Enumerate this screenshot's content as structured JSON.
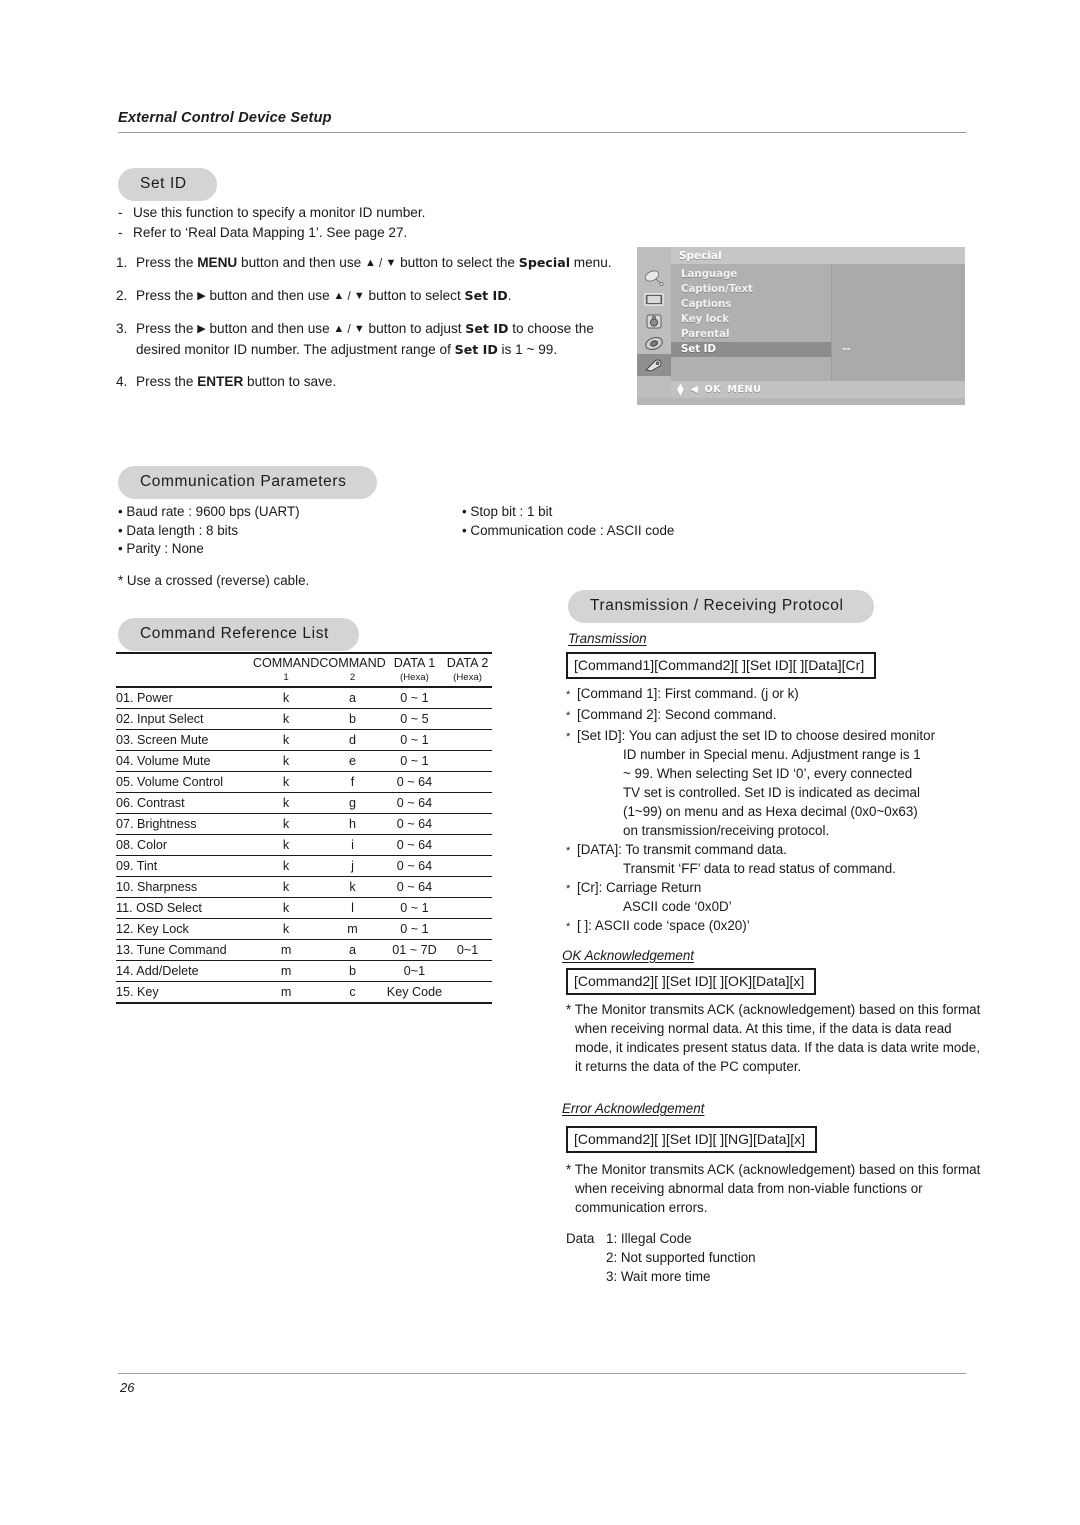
{
  "running_head": "External Control Device Setup",
  "page_number": "26",
  "set_id": {
    "heading": "Set ID",
    "notes": [
      "Use this function to specify a monitor ID number.",
      "Refer to ‘Real Data Mapping 1’. See page 27."
    ],
    "steps": [
      {
        "num": "1.",
        "parts": [
          {
            "t": "Press the ",
            "s": "n"
          },
          {
            "t": "MENU",
            "s": "b"
          },
          {
            "t": " button and then use ",
            "s": "n"
          },
          {
            "t": "▲",
            "s": "a"
          },
          {
            "t": " / ",
            "s": "sl"
          },
          {
            "t": "▼",
            "s": "a"
          },
          {
            "t": "  button to select the ",
            "s": "n"
          },
          {
            "t": "Special",
            "s": "bb"
          },
          {
            "t": " menu.",
            "s": "n"
          }
        ]
      },
      {
        "num": "2.",
        "parts": [
          {
            "t": "Press the ",
            "s": "n"
          },
          {
            "t": "▶",
            "s": "a"
          },
          {
            "t": " button and then use ",
            "s": "n"
          },
          {
            "t": "▲",
            "s": "a"
          },
          {
            "t": " / ",
            "s": "sl"
          },
          {
            "t": "▼",
            "s": "a"
          },
          {
            "t": "  button to select ",
            "s": "n"
          },
          {
            "t": "Set ID",
            "s": "bb"
          },
          {
            "t": ".",
            "s": "n"
          }
        ]
      },
      {
        "num": "3.",
        "parts": [
          {
            "t": "Press the ",
            "s": "n"
          },
          {
            "t": "▶",
            "s": "a"
          },
          {
            "t": " button and then use ",
            "s": "n"
          },
          {
            "t": "▲",
            "s": "a"
          },
          {
            "t": " / ",
            "s": "sl"
          },
          {
            "t": "▼",
            "s": "a"
          },
          {
            "t": " button to adjust  ",
            "s": "n"
          },
          {
            "t": "Set ID",
            "s": "bb"
          },
          {
            "t": " to choose the desired monitor ID number. The adjustment range of ",
            "s": "n"
          },
          {
            "t": "Set ID",
            "s": "bb"
          },
          {
            "t": " is 1 ~ 99.",
            "s": "n"
          }
        ]
      },
      {
        "num": "4.",
        "parts": [
          {
            "t": "Press the ",
            "s": "n"
          },
          {
            "t": "ENTER",
            "s": "b"
          },
          {
            "t": " button to save.",
            "s": "n"
          }
        ]
      }
    ]
  },
  "osd": {
    "title": "Special",
    "icons": [
      "satellite-dish-icon",
      "picture-screen-icon",
      "audio-speaker-icon",
      "timer-clock-icon",
      "special-tools-icon"
    ],
    "selected_icon_index": 4,
    "items": [
      "Language",
      "Caption/Text",
      "Captions",
      "Key lock",
      "Parental",
      "Set ID"
    ],
    "selected_item": "Set ID",
    "selected_value": "--",
    "footer_keys": [
      "◀",
      "OK",
      "MENU"
    ]
  },
  "communication_parameters": {
    "heading": "Communication Parameters",
    "left": [
      "Baud rate : 9600 bps (UART)",
      "Data length : 8 bits",
      "Parity : None"
    ],
    "right": [
      "Stop bit : 1 bit",
      "Communication code : ASCII code"
    ],
    "note": "* Use a crossed (reverse) cable."
  },
  "command_reference": {
    "heading": "Command Reference List",
    "columns": {
      "blank": "",
      "command1": "COMMAND",
      "command1_sub": "1",
      "command2": "COMMAND",
      "command2_sub": "2",
      "data1": "DATA 1",
      "data1_sub": "(Hexa)",
      "data2": "DATA 2",
      "data2_sub": "(Hexa)"
    },
    "rows": [
      {
        "name": "01. Power",
        "c1": "k",
        "c2": "a",
        "d1": "0 ~ 1",
        "d2": ""
      },
      {
        "name": "02. Input Select",
        "c1": "k",
        "c2": "b",
        "d1": "0 ~ 5",
        "d2": ""
      },
      {
        "name": "03. Screen Mute",
        "c1": "k",
        "c2": "d",
        "d1": "0 ~ 1",
        "d2": ""
      },
      {
        "name": "04. Volume Mute",
        "c1": "k",
        "c2": "e",
        "d1": "0 ~ 1",
        "d2": ""
      },
      {
        "name": "05. Volume Control",
        "c1": "k",
        "c2": "f",
        "d1": "0 ~ 64",
        "d2": ""
      },
      {
        "name": "06. Contrast",
        "c1": "k",
        "c2": "g",
        "d1": "0 ~ 64",
        "d2": ""
      },
      {
        "name": "07. Brightness",
        "c1": "k",
        "c2": "h",
        "d1": "0 ~ 64",
        "d2": ""
      },
      {
        "name": "08. Color",
        "c1": "k",
        "c2": "i",
        "d1": "0 ~ 64",
        "d2": ""
      },
      {
        "name": "09. Tint",
        "c1": "k",
        "c2": "j",
        "d1": "0 ~ 64",
        "d2": ""
      },
      {
        "name": "10. Sharpness",
        "c1": "k",
        "c2": "k",
        "d1": "0 ~ 64",
        "d2": ""
      },
      {
        "name": "11. OSD Select",
        "c1": "k",
        "c2": "l",
        "d1": "0 ~ 1",
        "d2": ""
      },
      {
        "name": "12. Key Lock",
        "c1": "k",
        "c2": "m",
        "d1": "0 ~ 1",
        "d2": ""
      },
      {
        "name": "13. Tune Command",
        "c1": "m",
        "c2": "a",
        "d1": "01 ~ 7D",
        "d2": "0~1"
      },
      {
        "name": "14. Add/Delete",
        "c1": "m",
        "c2": "b",
        "d1": "0~1",
        "d2": ""
      },
      {
        "name": "15. Key",
        "c1": "m",
        "c2": "c",
        "d1": "Key Code",
        "d2": ""
      }
    ]
  },
  "protocol": {
    "heading": "Transmission / Receiving  Protocol",
    "transmission": {
      "label": "Transmission",
      "format": "[Command1][Command2][  ][Set ID][  ][Data][Cr]",
      "bullets": [
        {
          "main": "[Command 1]: First command. (j or k)",
          "cont": []
        },
        {
          "main": "[Command 2]: Second command.",
          "cont": []
        },
        {
          "main": "[Set ID]: You can adjust the set ID to choose desired monitor",
          "cont": [
            "ID number in Special menu. Adjustment range is 1",
            "~ 99. When selecting Set ID ‘0’, every connected",
            "TV set is controlled. Set ID is indicated as decimal",
            "(1~99) on menu and as Hexa decimal (0x0~0x63)",
            "on transmission/receiving protocol."
          ]
        },
        {
          "main": "[DATA]: To transmit command data.",
          "cont": [
            "Transmit ‘FF’ data to read status of command."
          ]
        },
        {
          "main": "[Cr]: Carriage Return",
          "cont": [
            "ASCII code ‘0x0D’"
          ]
        },
        {
          "main": "[   ]: ASCII code ‘space (0x20)’",
          "cont": []
        }
      ]
    },
    "ok_ack": {
      "label": "OK Acknowledgement",
      "format": "[Command2][  ][Set ID][  ][OK][Data][x]",
      "text": "* The Monitor transmits ACK (acknowledgement) based on this format when receiving normal data. At this time, if the data is data read mode, it indicates present status data. If the data is data write mode, it returns the data of the PC computer."
    },
    "error_ack": {
      "label": "Error Acknowledgement",
      "format": "[Command2][  ][Set ID][  ][NG][Data][x]",
      "text": "* The Monitor transmits ACK (acknowledgement) based on this format when receiving abnormal data from non-viable functions or communication errors.",
      "data_label": "Data",
      "data_items": [
        "1: Illegal Code",
        "2: Not supported function",
        "3: Wait more time"
      ]
    }
  }
}
